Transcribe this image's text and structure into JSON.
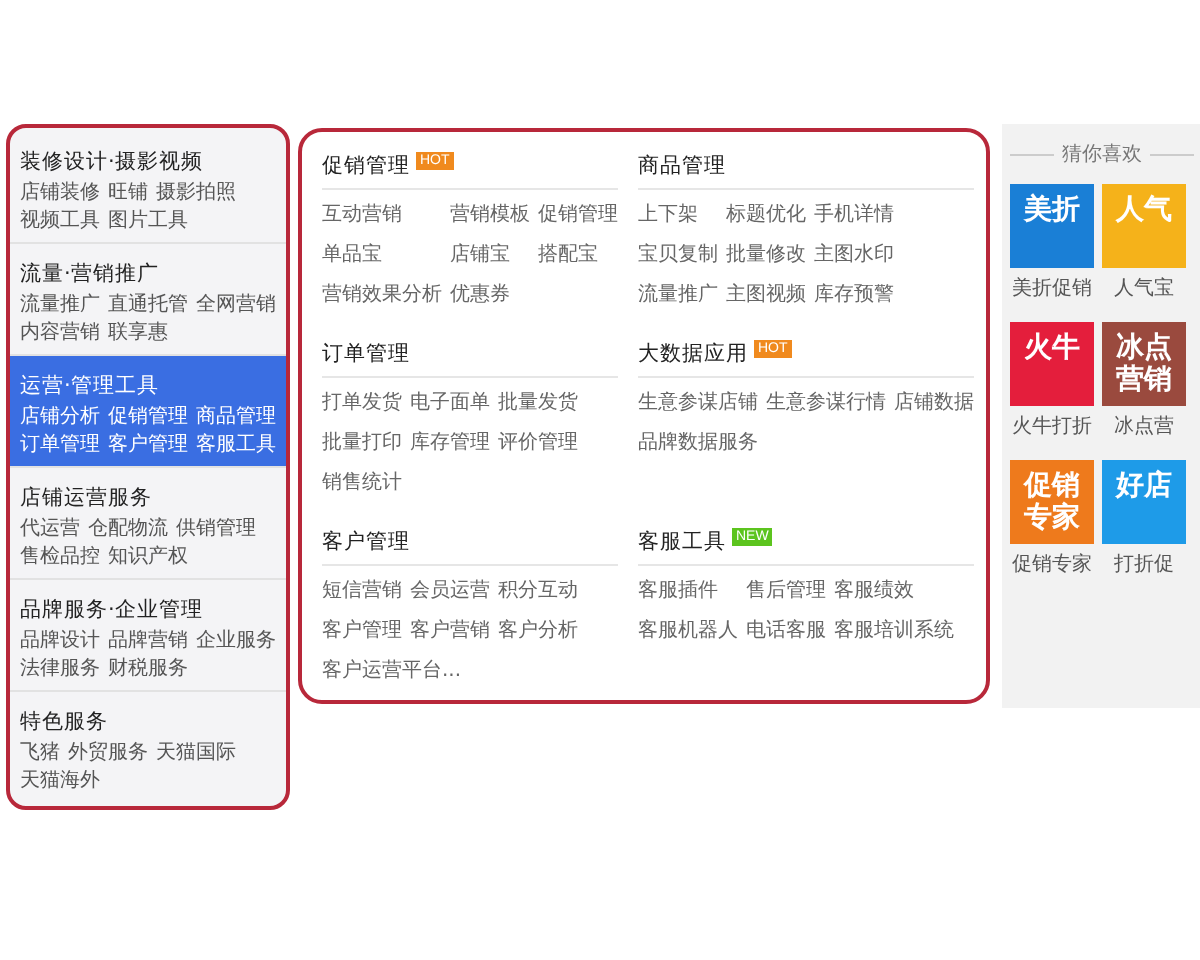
{
  "sidebar": {
    "groups": [
      {
        "title": "装修设计·摄影视频",
        "selected": false,
        "links": [
          "店铺装修",
          "旺铺",
          "摄影拍照",
          "视频工具",
          "图片工具"
        ]
      },
      {
        "title": "流量·营销推广",
        "selected": false,
        "links": [
          "流量推广",
          "直通托管",
          "全网营销",
          "内容营销",
          "联享惠"
        ]
      },
      {
        "title": "运营·管理工具",
        "selected": true,
        "links": [
          "店铺分析",
          "促销管理",
          "商品管理",
          "订单管理",
          "客户管理",
          "客服工具"
        ]
      },
      {
        "title": "店铺运营服务",
        "selected": false,
        "links": [
          "代运营",
          "仓配物流",
          "供销管理",
          "售检品控",
          "知识产权"
        ]
      },
      {
        "title": "品牌服务·企业管理",
        "selected": false,
        "links": [
          "品牌设计",
          "品牌营销",
          "企业服务",
          "法律服务",
          "财税服务"
        ]
      },
      {
        "title": "特色服务",
        "selected": false,
        "links": [
          "飞猪",
          "外贸服务",
          "天猫国际",
          "天猫海外"
        ]
      }
    ]
  },
  "panel": {
    "sections": [
      {
        "title": "促销管理",
        "badge": {
          "text": "HOT",
          "kind": "hot"
        },
        "links": [
          "互动营销",
          "营销模板",
          "促销管理",
          "单品宝",
          "店铺宝",
          "搭配宝",
          "营销效果分析",
          "优惠券"
        ]
      },
      {
        "title": "商品管理",
        "links": [
          "上下架",
          "标题优化",
          "手机详情",
          "宝贝复制",
          "批量修改",
          "主图水印",
          "流量推广",
          "主图视频",
          "库存预警"
        ]
      },
      {
        "title": "订单管理",
        "links": [
          "打单发货",
          "电子面单",
          "批量发货",
          "批量打印",
          "库存管理",
          "评价管理",
          "销售统计"
        ]
      },
      {
        "title": "大数据应用",
        "badge": {
          "text": "HOT",
          "kind": "hot"
        },
        "links": [
          "生意参谋店铺",
          "生意参谋行情",
          "店铺数据",
          "品牌数据服务"
        ]
      },
      {
        "title": "客户管理",
        "links": [
          "短信营销",
          "会员运营",
          "积分互动",
          "客户管理",
          "客户营销",
          "客户分析",
          "客户运营平台..."
        ]
      },
      {
        "title": "客服工具",
        "badge": {
          "text": "NEW",
          "kind": "new"
        },
        "links": [
          "客服插件",
          "售后管理",
          "客服绩效",
          "客服机器人",
          "电话客服",
          "客服培训系统"
        ]
      }
    ]
  },
  "recommend": {
    "title": "猜你喜欢",
    "apps": [
      {
        "logo": [
          "美折"
        ],
        "name": "美折促销",
        "color": "#1a7fd6"
      },
      {
        "logo": [
          "人气"
        ],
        "name": "人气宝",
        "color": "#f5b21a"
      },
      {
        "logo": [
          "火牛"
        ],
        "name": "火牛打折",
        "color": "#e41e3c"
      },
      {
        "logo": [
          "冰点",
          "营销"
        ],
        "name": "冰点营",
        "color": "#9a4a3e"
      },
      {
        "logo": [
          "促销",
          "专家"
        ],
        "name": "促销专家",
        "color": "#ee7a1c"
      },
      {
        "logo": [
          "好店"
        ],
        "name": "打折促",
        "color": "#1e9be8"
      }
    ]
  }
}
